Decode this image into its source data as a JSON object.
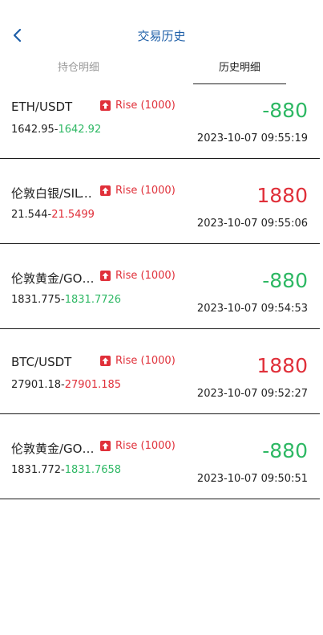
{
  "header": {
    "title": "交易历史",
    "back_icon": "chevron-left-icon"
  },
  "tabs": [
    {
      "label": "持仓明细",
      "active": false
    },
    {
      "label": "历史明细",
      "active": true
    }
  ],
  "colors": {
    "title": "#1e5fa8",
    "up": "#e0303a",
    "down": "#2eb864",
    "text": "#222222",
    "muted": "#9a9a9a",
    "badge": "#e0303a"
  },
  "trades": [
    {
      "pair": "ETH/USDT",
      "direction": "Rise (1000)",
      "direction_icon": "arrow-up-icon",
      "open_price": "1642.95-",
      "close_price": "1642.92",
      "close_color": "#2eb864",
      "pnl": "-880",
      "pnl_color": "#2eb864",
      "time": "2023-10-07 09:55:19"
    },
    {
      "pair": "伦敦白银/SILVER",
      "direction": "Rise (1000)",
      "direction_icon": "arrow-up-icon",
      "open_price": "21.544-",
      "close_price": "21.5499",
      "close_color": "#e0303a",
      "pnl": "1880",
      "pnl_color": "#e0303a",
      "time": "2023-10-07 09:55:06"
    },
    {
      "pair": "伦敦黄金/GOLD",
      "direction": "Rise (1000)",
      "direction_icon": "arrow-up-icon",
      "open_price": "1831.775-",
      "close_price": "1831.7726",
      "close_color": "#2eb864",
      "pnl": "-880",
      "pnl_color": "#2eb864",
      "time": "2023-10-07 09:54:53"
    },
    {
      "pair": "BTC/USDT",
      "direction": "Rise (1000)",
      "direction_icon": "arrow-up-icon",
      "open_price": "27901.18-",
      "close_price": "27901.185",
      "close_color": "#e0303a",
      "pnl": "1880",
      "pnl_color": "#e0303a",
      "time": "2023-10-07 09:52:27"
    },
    {
      "pair": "伦敦黄金/GOLD",
      "direction": "Rise (1000)",
      "direction_icon": "arrow-up-icon",
      "open_price": "1831.772-",
      "close_price": "1831.7658",
      "close_color": "#2eb864",
      "pnl": "-880",
      "pnl_color": "#2eb864",
      "time": "2023-10-07 09:50:51"
    }
  ]
}
